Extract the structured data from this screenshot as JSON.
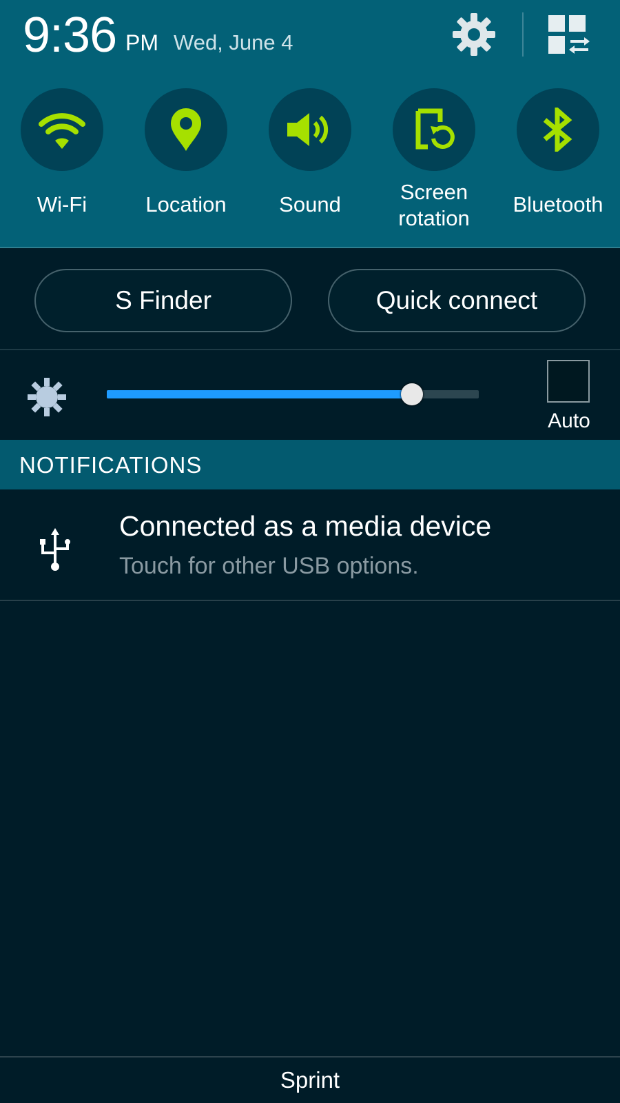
{
  "status": {
    "time": "9:36",
    "ampm": "PM",
    "date": "Wed, June 4"
  },
  "header_icons": [
    "gear-icon",
    "edit-toggles-icon"
  ],
  "toggles": [
    {
      "label": "Wi-Fi",
      "icon": "wifi-icon"
    },
    {
      "label": "Location",
      "icon": "location-pin-icon"
    },
    {
      "label": "Sound",
      "icon": "speaker-icon"
    },
    {
      "label_line1": "Screen",
      "label_line2": "rotation",
      "icon": "screen-rotation-icon"
    },
    {
      "label": "Bluetooth",
      "icon": "bluetooth-icon"
    }
  ],
  "quick_buttons": {
    "s_finder": "S Finder",
    "quick_connect": "Quick connect"
  },
  "brightness": {
    "level": 0.82,
    "auto_label": "Auto",
    "auto_checked": false
  },
  "notifications": {
    "section_title": "NOTIFICATIONS",
    "items": [
      {
        "title": "Connected as a media device",
        "subtitle": "Touch for other USB options.",
        "icon": "usb-icon"
      }
    ]
  },
  "footer": {
    "carrier": "Sprint"
  },
  "colors": {
    "header_bg": "#036177",
    "toggle_circle": "#014256",
    "toggle_active_icon": "#a6e000",
    "body_bg": "#001c28",
    "slider_fill": "#1e9bff",
    "section_header": "#035a6f"
  }
}
